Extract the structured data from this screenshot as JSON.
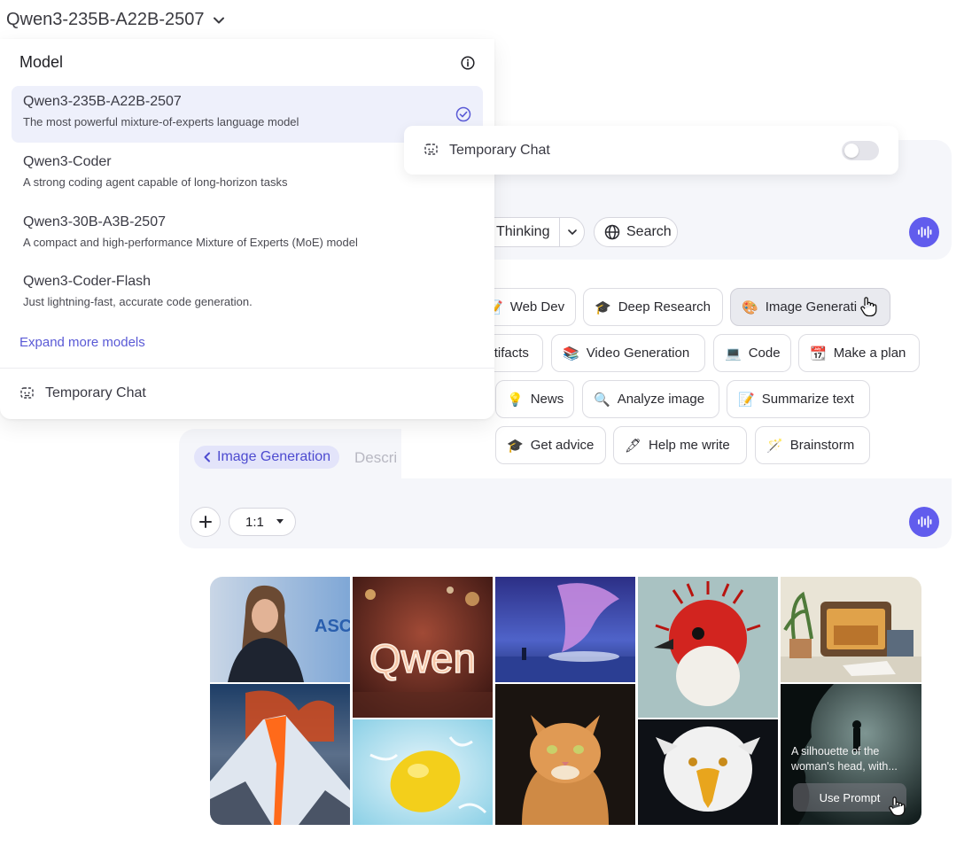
{
  "header": {
    "model_name": "Qwen3-235B-A22B-2507"
  },
  "model_panel": {
    "title": "Model",
    "models": [
      {
        "name": "Qwen3-235B-A22B-2507",
        "desc": "The most powerful mixture-of-experts language model",
        "selected": true
      },
      {
        "name": "Qwen3-Coder",
        "desc": "A strong coding agent capable of long-horizon tasks"
      },
      {
        "name": "Qwen3-30B-A3B-2507",
        "desc": "A compact and high-performance Mixture of Experts (MoE) model"
      },
      {
        "name": "Qwen3-Coder-Flash",
        "desc": "Just lightning-fast, accurate code generation."
      }
    ],
    "expand_label": "Expand more models",
    "temporary_label": "Temporary Chat"
  },
  "temp_bar": {
    "label": "Temporary Chat",
    "enabled": false
  },
  "chat_box": {
    "thinking_label": "Thinking",
    "search_label": "Search"
  },
  "chips": [
    {
      "emoji": "📝",
      "label": "Web Dev"
    },
    {
      "emoji": "🎓",
      "label": "Deep Research"
    },
    {
      "emoji": "🎨",
      "label": "Image Generati"
    },
    {
      "emoji": "🧩",
      "label": "Artifacts"
    },
    {
      "emoji": "📚",
      "label": "Video Generation"
    },
    {
      "emoji": "💻",
      "label": "Code"
    },
    {
      "emoji": "📆",
      "label": "Make a plan"
    },
    {
      "emoji": "💡",
      "label": "News"
    },
    {
      "emoji": "🔍",
      "label": "Analyze image"
    },
    {
      "emoji": "📝",
      "label": "Summarize text"
    },
    {
      "emoji": "🎓",
      "label": "Get advice"
    },
    {
      "emoji": "🖋",
      "label": "Help me write"
    },
    {
      "emoji": "🪄",
      "label": "Brainstorm"
    }
  ],
  "gen_box": {
    "tag_label": "Image Generation",
    "placeholder": "Descri",
    "ratio": "1:1"
  },
  "gallery": {
    "overlay_text": "A silhouette of the woman's head, with...",
    "use_prompt_label": "Use Prompt",
    "tile_qwen_text": "Qwen",
    "tile_asc_text": "ASC"
  },
  "colors": {
    "accent": "#615ced",
    "tag_bg": "#e3e4fa",
    "panel_selected": "#eef0fb"
  }
}
